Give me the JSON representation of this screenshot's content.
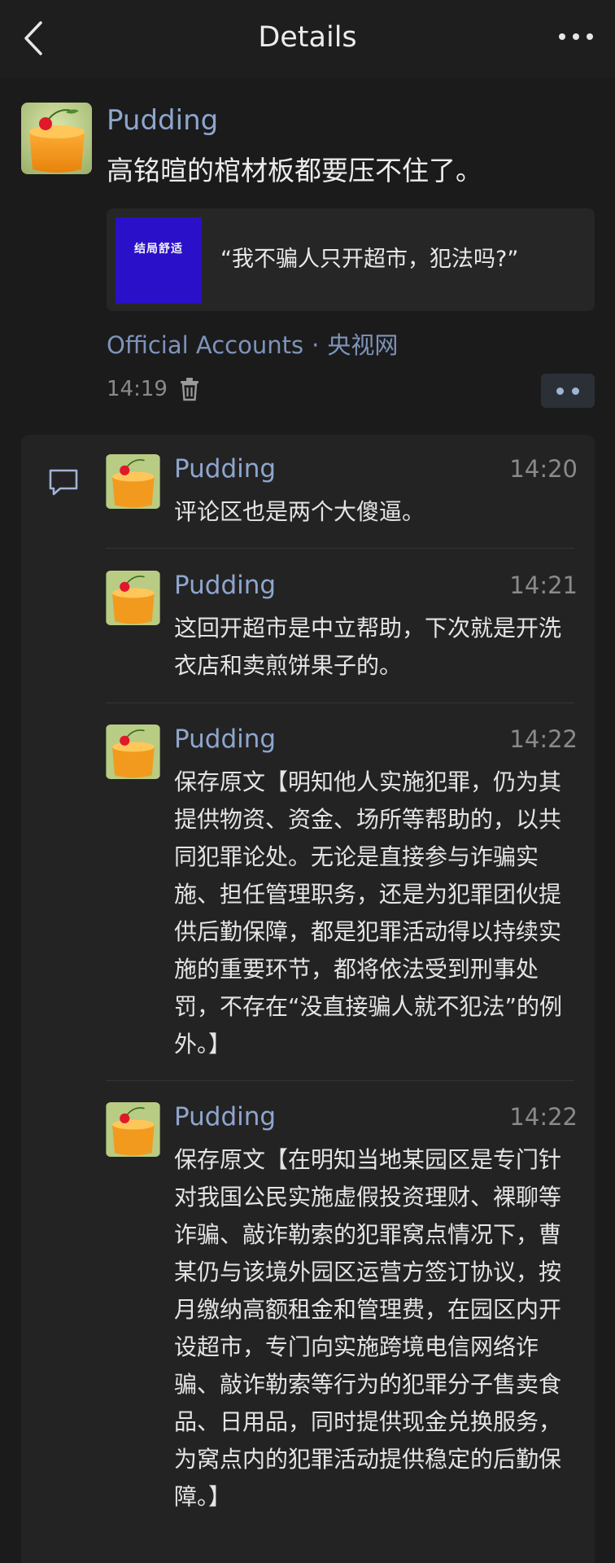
{
  "header": {
    "title": "Details",
    "back_icon": "chevron-left-icon",
    "more_icon": "more-dots-icon"
  },
  "post": {
    "author": "Pudding",
    "text": "高铭暄的棺材板都要压不住了。",
    "link": {
      "thumbnail_text": "结局舒适",
      "title": "“我不骗人只开超市，犯法吗?”"
    },
    "source_label": "Official Accounts",
    "source_separator": "·",
    "source_name": "央视网",
    "time": "14:19",
    "delete_icon": "trash-icon"
  },
  "comments": [
    {
      "author": "Pudding",
      "time": "14:20",
      "text": "评论区也是两个大傻逼。"
    },
    {
      "author": "Pudding",
      "time": "14:21",
      "text": "这回开超市是中立帮助，下次就是开洗衣店和卖煎饼果子的。"
    },
    {
      "author": "Pudding",
      "time": "14:22",
      "text": "保存原文【明知他人实施犯罪，仍为其提供物资、资金、场所等帮助的，以共同犯罪论处。无论是直接参与诈骗实施、担任管理职务，还是为犯罪团伙提供后勤保障，都是犯罪活动得以持续实施的重要环节，都将依法受到刑事处罚，不存在“没直接骗人就不犯法”的例外。】"
    },
    {
      "author": "Pudding",
      "time": "14:22",
      "text": "保存原文【在明知当地某园区是专门针对我国公民实施虚假投资理财、裸聊等诈骗、敲诈勒索的犯罪窝点情况下，曹某仍与该境外园区运营方签订协议，按月缴纳高额租金和管理费，在园区内开设超市，专门向实施跨境电信网络诈骗、敲诈勒索等行为的犯罪分子售卖食品、日用品，同时提供现金兑换服务，为窝点内的犯罪活动提供稳定的后勤保障。】"
    }
  ],
  "colors": {
    "background": "#1b1b1b",
    "author_blue": "#8ea6cf",
    "thumbnail_bg": "#2a10c8"
  }
}
